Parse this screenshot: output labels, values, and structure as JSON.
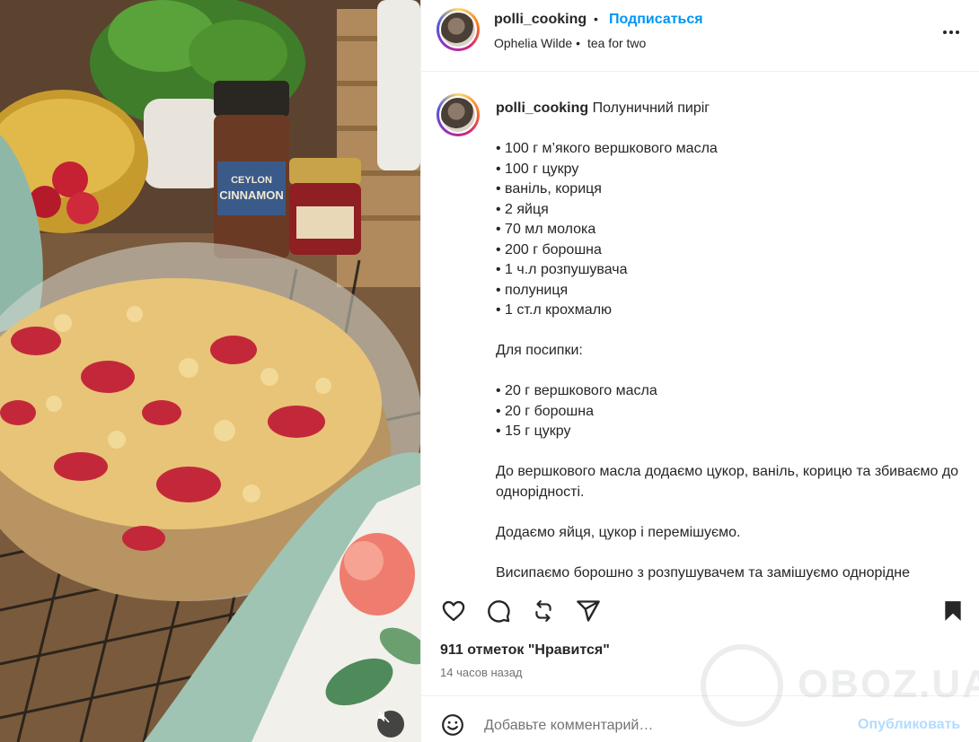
{
  "header": {
    "username": "polli_cooking",
    "separator": "•",
    "follow_label": "Подписаться",
    "audio_artist": "Ophelia Wilde",
    "audio_separator": "•",
    "audio_track": "tea for two"
  },
  "caption": {
    "username": "polli_cooking",
    "title": "Полуничний пиріг",
    "lines": [
      "",
      "• 100 г м’якого вершкового масла",
      "• 100 г цукру",
      "• ваніль, кориця",
      "• 2 яйця",
      "• 70 мл молока",
      "• 200 г борошна",
      "• 1 ч.л розпушувача",
      "• полуниця",
      "• 1 ст.л крохмалю",
      "",
      "Для посипки:",
      "",
      "• 20 г вершкового масла",
      "• 20 г борошна",
      "• 15 г цукру",
      "",
      "До вершкового масла додаємо цукор, ваніль, корицю та збиваємо до однорідності.",
      "",
      "Додаємо яйця, цукор і перемішуємо.",
      "",
      "Висипаємо борошно з розпушувачем та замішуємо однорідне"
    ]
  },
  "actions": {
    "like_icon": "heart-icon",
    "comment_icon": "comment-icon",
    "repost_icon": "repost-icon",
    "share_icon": "share-icon",
    "save_icon": "bookmark-icon"
  },
  "likes_text": "911 отметок \"Нравится\"",
  "time_text": "14 часов назад",
  "comment": {
    "placeholder": "Добавьте комментарий…",
    "publish_label": "Опубликовать"
  },
  "media": {
    "jar_label_1": "CEYLON",
    "jar_label_2": "CINNAMON"
  },
  "watermark": {
    "text": "OBOZ.UA"
  },
  "colors": {
    "accent": "#0095f6",
    "publish_disabled": "#b3dbff",
    "text": "#262626",
    "secondary": "#737373",
    "border": "#efefef"
  }
}
